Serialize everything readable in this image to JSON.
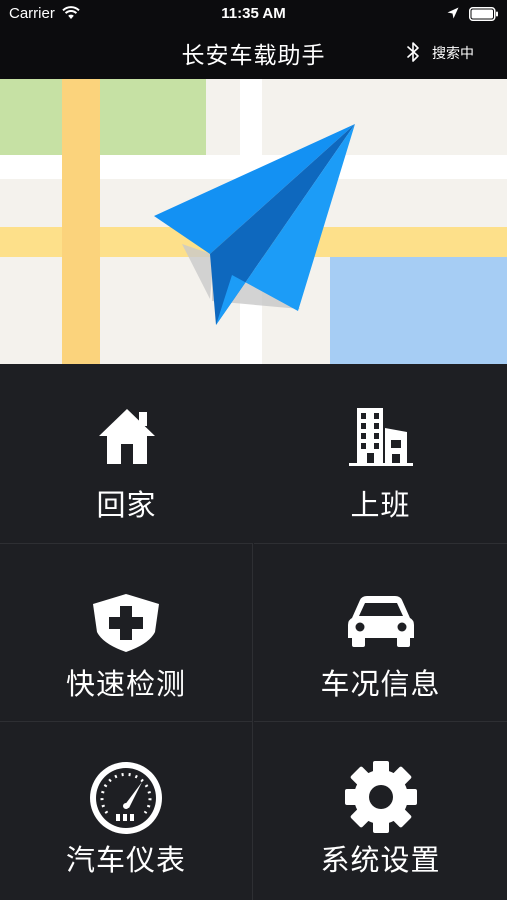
{
  "status_bar": {
    "carrier": "Carrier",
    "time": "11:35 AM"
  },
  "nav": {
    "title": "长安车载助手",
    "bluetooth_status": "搜索中"
  },
  "menu": {
    "home": "回家",
    "work": "上班",
    "quick_check": "快速检测",
    "vehicle_info": "车况信息",
    "dashboard": "汽车仪表",
    "settings": "系统设置"
  },
  "colors": {
    "accent_blue": "#1391f3",
    "background": "#1e1f23",
    "bar": "#0c0c0e"
  }
}
